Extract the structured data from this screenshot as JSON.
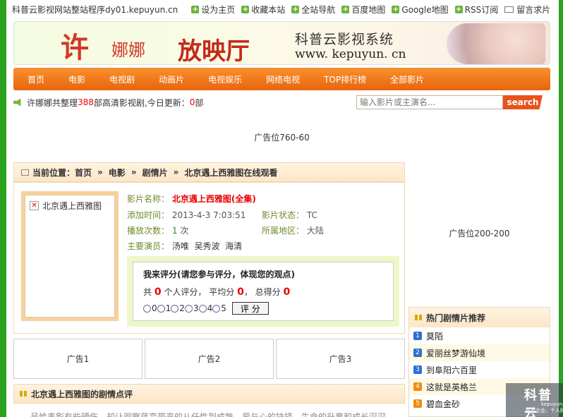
{
  "topbar": {
    "site": "科普云影视网站整站程序dy01.kepuyun.cn",
    "links": [
      "设为主页",
      "收藏本站",
      "全站导航",
      "百度地图",
      "Google地图",
      "RSS订阅",
      "留言求片"
    ]
  },
  "banner": {
    "xu": "许",
    "nana": "娜娜",
    "title": "放映厅",
    "brand": "科普云影视系统",
    "url": "www. kepuyun. cn"
  },
  "nav": [
    "首页",
    "电影",
    "电视剧",
    "动画片",
    "电视娱乐",
    "网络电视",
    "TOP排行榜",
    "全部影片"
  ],
  "notice": {
    "prefix": "许娜娜共整理",
    "count": "388",
    "middle": "部高清影视剧,今日更新：",
    "today": "0",
    "suffix": "部"
  },
  "search": {
    "placeholder": "输入影片或主演名...",
    "button": "search"
  },
  "ads": {
    "top": "广告位760-60",
    "side": "广告位200-200",
    "slots": [
      "广告1",
      "广告2",
      "广告3"
    ]
  },
  "breadcrumb": {
    "label": "当前位置：",
    "items": [
      "首页",
      "电影",
      "剧情片",
      "北京遇上西雅图在线观看"
    ],
    "sep": "»"
  },
  "movie": {
    "poster_alt": "北京遇上西雅图",
    "name_label": "影片名称：",
    "name": "北京遇上西雅图(全集)",
    "added_label": "添加时间：",
    "added": "2013-4-3 7:03:51",
    "status_label": "影片状态：",
    "status": "TC",
    "plays_label": "播放次数：",
    "plays": "1",
    "plays_unit": "次",
    "region_label": "所属地区：",
    "region": "大陆",
    "actors_label": "主要演员：",
    "actors": [
      "汤唯",
      "吴秀波",
      "海清"
    ]
  },
  "rating": {
    "title": "我来评分(请您参与评分，体现您的观点)",
    "s1": "共",
    "people": "0",
    "s2": "个人评分， 平均分",
    "avg": "0",
    "s3": "， 总得分",
    "total": "0",
    "options": [
      "0",
      "1",
      "2",
      "3",
      "4",
      "5"
    ],
    "button": "评 分"
  },
  "review": {
    "title": "北京遇上西雅图的剧情点评",
    "text": "吴姓表影有些硬伤，却让观察蒋变带来的从任性到成熟，爱与心的抉择，生命的升育和成长深深"
  },
  "hot": {
    "title": "热门剧情片推荐",
    "items": [
      {
        "num": "1",
        "title": "莫陌"
      },
      {
        "num": "2",
        "title": "爱丽丝梦游仙境"
      },
      {
        "num": "3",
        "title": "到阜阳六百里"
      },
      {
        "num": "4",
        "title": "这就是英格兰"
      },
      {
        "num": "5",
        "title": "碧血金砂"
      }
    ]
  },
  "watermark": {
    "title": "科普云",
    "url": "kepuyun.cn",
    "sub": "普及企业、个人网站建设"
  }
}
